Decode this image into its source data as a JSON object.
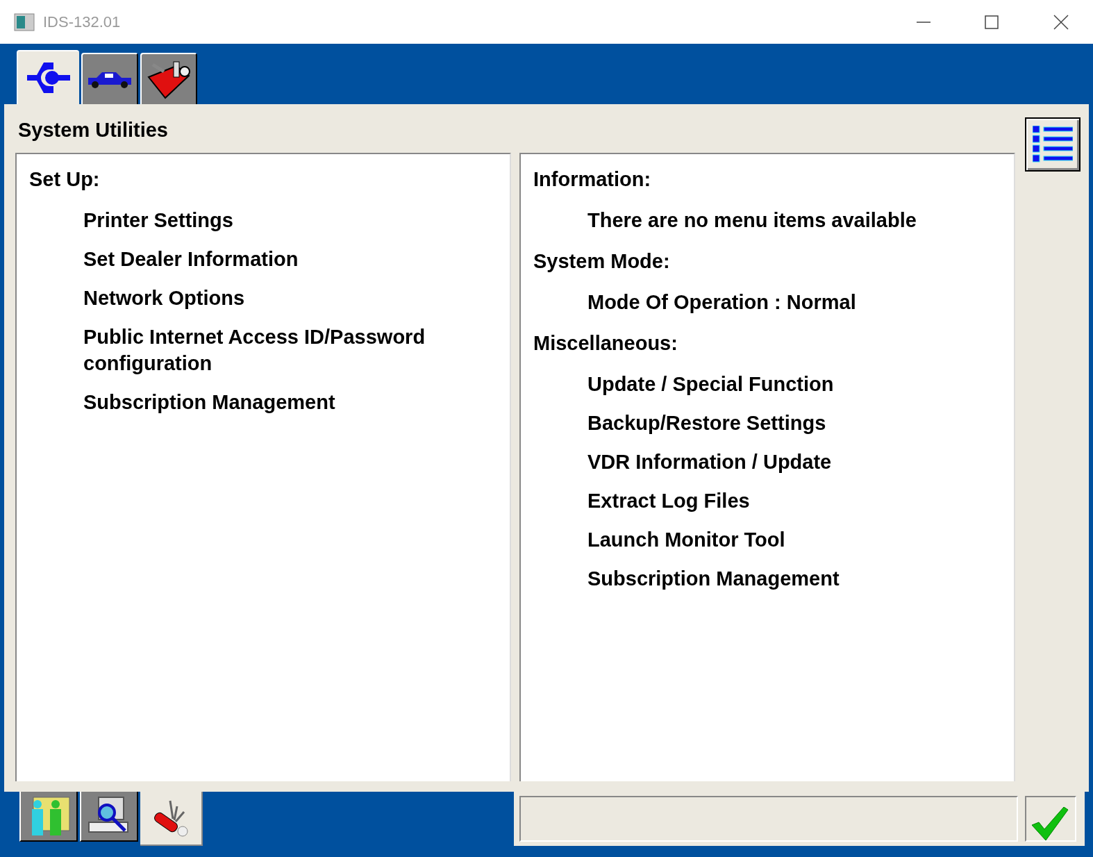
{
  "window": {
    "title": "IDS-132.01"
  },
  "top_tabs": [
    {
      "kind": "back",
      "selected": true
    },
    {
      "kind": "vehicle",
      "selected": false
    },
    {
      "kind": "toolbox",
      "selected": false
    }
  ],
  "page_title": "System Utilities",
  "panels": [
    {
      "sections": [
        {
          "heading": "Set Up:",
          "items": [
            "Printer Settings",
            "Set Dealer Information",
            "Network Options",
            "Public Internet Access ID/Password configuration",
            "Subscription Management"
          ]
        }
      ]
    },
    {
      "sections": [
        {
          "heading": "Information:",
          "items": [
            "There are no menu items available"
          ]
        },
        {
          "heading": "System Mode:",
          "items": [
            "Mode Of Operation : Normal"
          ]
        },
        {
          "heading": "Miscellaneous:",
          "items": [
            "Update / Special Function",
            "Backup/Restore Settings",
            "VDR Information / Update",
            "Extract Log Files",
            "Launch Monitor Tool",
            "Subscription Management"
          ]
        }
      ]
    }
  ],
  "bottom_tabs": [
    {
      "kind": "people",
      "selected": false
    },
    {
      "kind": "computer",
      "selected": false
    },
    {
      "kind": "knife",
      "selected": true
    }
  ]
}
